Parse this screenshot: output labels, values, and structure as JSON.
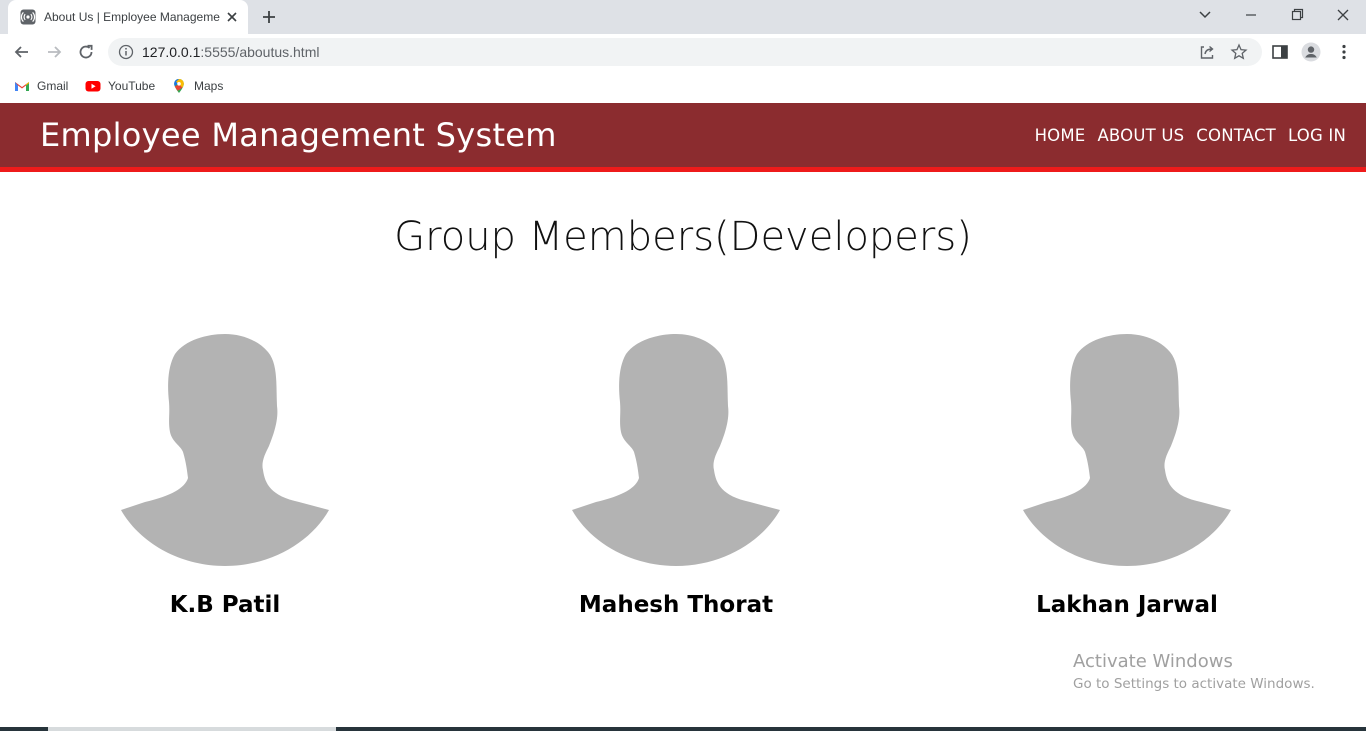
{
  "browser": {
    "tab_title": "About Us | Employee Manageme",
    "url_host": "127.0.0.1",
    "url_rest": ":5555/aboutus.html",
    "bookmarks": [
      {
        "label": "Gmail",
        "icon": "gmail-icon"
      },
      {
        "label": "YouTube",
        "icon": "youtube-icon"
      },
      {
        "label": "Maps",
        "icon": "maps-icon"
      }
    ]
  },
  "site": {
    "brand": "Employee Management System",
    "nav": [
      "HOME",
      "ABOUT US",
      "CONTACT",
      "LOG IN"
    ],
    "header_color": "#8b2c2f",
    "accent_line_color": "#ee1b1b"
  },
  "main": {
    "title": "Group Members(Developers)",
    "members": [
      {
        "name": "K.B Patil",
        "avatar_icon": "person-silhouette-icon"
      },
      {
        "name": "Mahesh Thorat",
        "avatar_icon": "person-silhouette-icon"
      },
      {
        "name": "Lakhan Jarwal",
        "avatar_icon": "person-silhouette-icon"
      }
    ]
  },
  "watermark": {
    "title": "Activate Windows",
    "subtitle": "Go to Settings to activate Windows."
  }
}
